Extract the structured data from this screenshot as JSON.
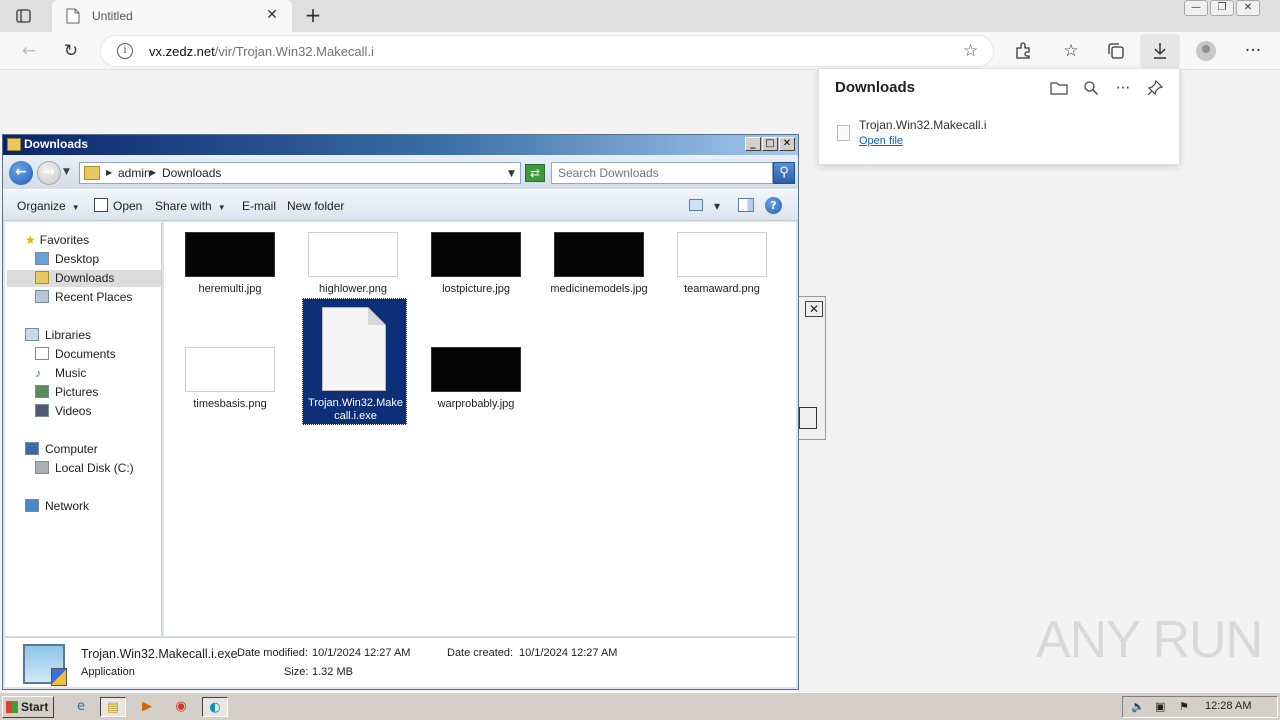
{
  "browser": {
    "tab_title": "Untitled",
    "url_host": "vx.zedz.net",
    "url_path": "/vir/Trojan.Win32.Makecall.i"
  },
  "downloads_flyout": {
    "title": "Downloads",
    "item_name": "Trojan.Win32.Makecall.i",
    "item_action": "Open file"
  },
  "explorer": {
    "title": "Downloads",
    "breadcrumb": [
      "admin",
      "Downloads"
    ],
    "search_placeholder": "Search Downloads",
    "commands": {
      "organize": "Organize",
      "open": "Open",
      "share_with": "Share with",
      "email": "E-mail",
      "new_folder": "New folder"
    },
    "nav": {
      "favorites": "Favorites",
      "desktop": "Desktop",
      "downloads": "Downloads",
      "recent_places": "Recent Places",
      "libraries": "Libraries",
      "documents": "Documents",
      "music": "Music",
      "pictures": "Pictures",
      "videos": "Videos",
      "computer": "Computer",
      "local_disk": "Local Disk (C:)",
      "network": "Network"
    },
    "files": [
      {
        "name": "heremulti.jpg",
        "thumb": "dark"
      },
      {
        "name": "highlower.png",
        "thumb": "light"
      },
      {
        "name": "lostpicture.jpg",
        "thumb": "dark"
      },
      {
        "name": "medicinemodels.jpg",
        "thumb": "dark"
      },
      {
        "name": "teamaward.png",
        "thumb": "light"
      },
      {
        "name": "timesbasis.png",
        "thumb": "light"
      },
      {
        "name": "Trojan.Win32.Makecall.i.exe",
        "thumb": "document"
      },
      {
        "name": "warprobably.jpg",
        "thumb": "dark"
      }
    ],
    "selected_file_label": "Trojan.Win32.Make call.i.exe",
    "details": {
      "filename": "Trojan.Win32.Makecall.i.exe",
      "type": "Application",
      "modified_label": "Date modified:",
      "modified_value": "10/1/2024 12:27 AM",
      "created_label": "Date created:",
      "created_value": "10/1/2024 12:27 AM",
      "size_label": "Size:",
      "size_value": "1.32 MB"
    }
  },
  "taskbar": {
    "start_label": "Start",
    "clock": "12:28 AM"
  },
  "watermark": "ANY RUN"
}
